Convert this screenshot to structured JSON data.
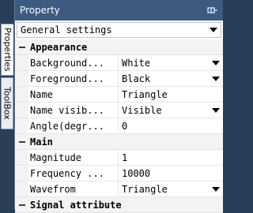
{
  "side_tabs": {
    "properties": "Properties",
    "toolbox": "ToolBox"
  },
  "panel": {
    "title": "Property",
    "selector_value": "General settings"
  },
  "categories": {
    "appearance": "Appearance",
    "main": "Main",
    "signal": "Signal attribute"
  },
  "appearance_rows": [
    {
      "name": "Background...",
      "value": "White"
    },
    {
      "name": "Foreground...",
      "value": "Black"
    },
    {
      "name": "Name",
      "value": "Triangle"
    },
    {
      "name": "Name visib...",
      "value": "Visible"
    },
    {
      "name": "Angle(degr...",
      "value": "0"
    }
  ],
  "main_rows": [
    {
      "name": "Magnitude",
      "value": "1"
    },
    {
      "name": "Frequency ...",
      "value": "10000"
    },
    {
      "name": "Wavefrom",
      "value": "Triangle"
    }
  ],
  "colors": {
    "titlebar": "#3d5a80",
    "frame": "#2a3d57"
  }
}
